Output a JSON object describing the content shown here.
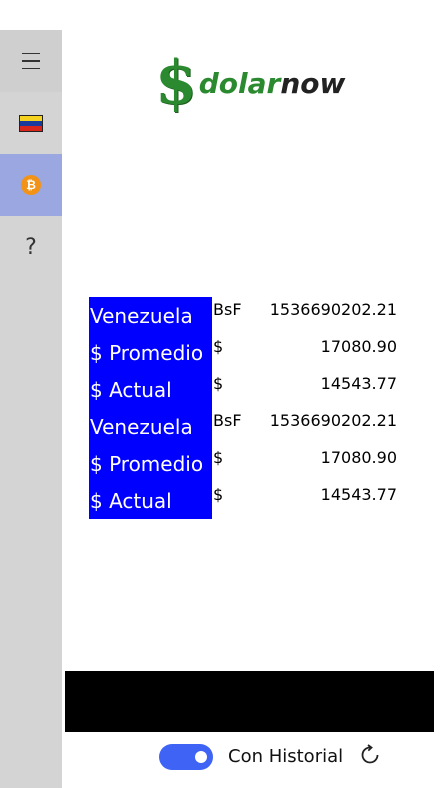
{
  "sidebar": {
    "items": [
      {
        "icon": "hamburger-menu-icon"
      },
      {
        "icon": "venezuela-flag-icon"
      },
      {
        "icon": "bitcoin-icon",
        "active": true
      },
      {
        "icon": "help-icon",
        "glyph": "?"
      }
    ]
  },
  "logo": {
    "symbol": "$",
    "word_part1": "dolar",
    "word_part2": "now"
  },
  "rates": [
    {
      "label": "Venezuela",
      "currency": "BsF",
      "value": "1536690202.21"
    },
    {
      "label": "$ Promedio",
      "currency": "$",
      "value": "17080.90"
    },
    {
      "label": "$ Actual",
      "currency": "$",
      "value": "14543.77"
    },
    {
      "label": "Venezuela",
      "currency": "BsF",
      "value": "1536690202.21"
    },
    {
      "label": "$ Promedio",
      "currency": "$",
      "value": "17080.90"
    },
    {
      "label": "$ Actual",
      "currency": "$",
      "value": "14543.77"
    }
  ],
  "footer": {
    "toggle_label": "Con Historial",
    "toggle_on": true
  },
  "colors": {
    "label_bg": "#0000ff",
    "accent": "#3e63f5",
    "sidebar_active": "#9aa7e0"
  }
}
